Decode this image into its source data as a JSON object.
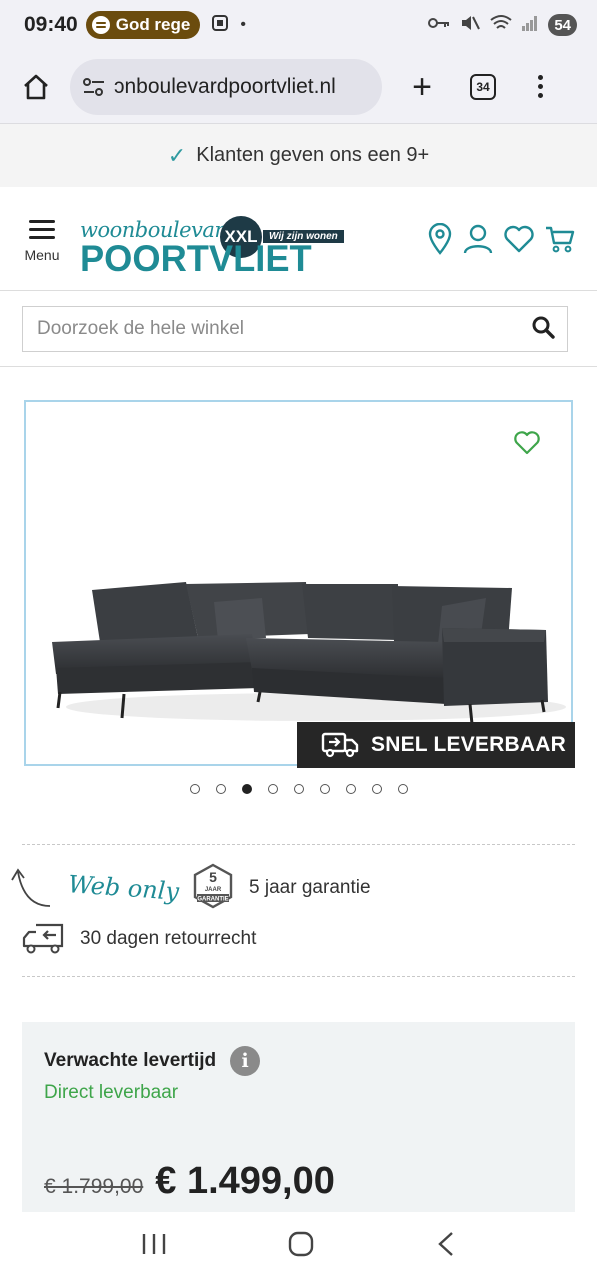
{
  "status_bar": {
    "time": "09:40",
    "now_playing": "God rege",
    "battery": "54",
    "icons": [
      "spotify-icon",
      "screenshot-icon",
      "key-icon",
      "mute-icon",
      "wifi-icon",
      "signal-icon"
    ]
  },
  "browser": {
    "url": "ɔnboulevardpoortvliet.nl",
    "tab_count": "34",
    "new_tab_label": "+"
  },
  "trust_bar": {
    "text": "Klanten geven ons een 9+"
  },
  "header": {
    "menu_label": "Menu",
    "logo_top": "woonboulevard",
    "logo_xxl": "XXL",
    "logo_tagline": "Wij zijn wonen",
    "logo_main": "POORTVLIET"
  },
  "search": {
    "placeholder": "Doorzoek de hele winkel"
  },
  "product": {
    "delivery_badge": "SNEL LEVERBAAR",
    "carousel": {
      "count": 9,
      "active_index": 2
    }
  },
  "usps": {
    "web_only": "Web only",
    "badge_top": "5",
    "badge_mid": "JAAR",
    "badge_bottom": "GARANTIE",
    "guarantee": "5 jaar garantie",
    "returns": "30 dagen retourrecht"
  },
  "delivery": {
    "title": "Verwachte levertijd",
    "info_symbol": "i",
    "status": "Direct leverbaar",
    "old_price": "€ 1.799,00",
    "new_price": "€ 1.499,00"
  },
  "colors": {
    "brand_teal": "#1f8b95",
    "brand_dark": "#1e3a46",
    "success_green": "#3ea54a",
    "badge_dark": "#262626"
  }
}
